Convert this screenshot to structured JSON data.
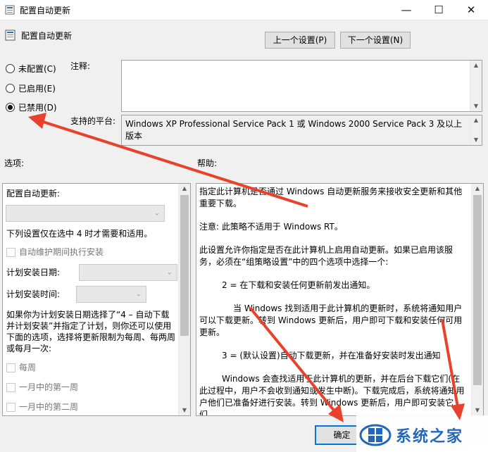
{
  "window": {
    "title": "配置自动更新",
    "minimize_icon": "minimize-icon",
    "maximize_icon": "maximize-icon",
    "close_icon": "close-icon"
  },
  "header": {
    "policy_name": "配置自动更新",
    "prev_button": "上一个设置(P)",
    "next_button": "下一个设置(N)"
  },
  "state_options": [
    {
      "label": "未配置(C)",
      "selected": false
    },
    {
      "label": "已启用(E)",
      "selected": false
    },
    {
      "label": "已禁用(D)",
      "selected": true
    }
  ],
  "comment": {
    "label": "注释:",
    "value": ""
  },
  "platform": {
    "label": "支持的平台:",
    "value": "Windows XP Professional Service Pack 1 或 Windows 2000 Service Pack 3 及以上版本"
  },
  "options_label": "选项:",
  "help_label": "帮助:",
  "options": {
    "configure_label": "配置自动更新:",
    "note": "下列设置仅在选中 4 时才需要和适用。",
    "maintenance_checkbox": "自动维护期间执行安装",
    "install_day_label": "计划安装日期:",
    "install_time_label": "计划安装时间:",
    "paragraph": "如果你为计划安装日期选择了“4 – 自动下载并计划安装”并指定了计划，则你还可以使用下面的选项，选择将更新限制为每周、每两周或每月一次:",
    "weekly_checkbox": "每周",
    "first_week_checkbox": "一月中的第一周",
    "second_week_checkbox": "一月中的第二周"
  },
  "help": {
    "p1": "指定此计算机是否通过 Windows 自动更新服务来接收安全更新和其他重要下载。",
    "p2": "注意: 此策略不适用于 Windows RT。",
    "p3": "此设置允许你指定是否在此计算机上启用自动更新。如果已启用该服务，必须在“组策略设置”中的四个选项中选择一个:",
    "p4": "2 = 在下载和安装任何更新前发出通知。",
    "p5": "当 Windows 找到适用于此计算机的更新时，系统将通知用户可以下载更新。转到 Windows 更新后，用户即可下载和安装任何可用更新。",
    "p6": "3 = (默认设置)自动下载更新，并在准备好安装时发出通知",
    "p7": "Windows 会查找适用于此计算机的更新，并在后台下载它们(在此过程中，用户不会收到通知或发生中断)。下载完成后，系统将通知用户他们已准备好进行安装。转到 Windows 更新后，用户即可安装它们。"
  },
  "footer": {
    "ok_button": "确定"
  },
  "watermark": {
    "text": "系统之家"
  },
  "colors": {
    "annotation_arrow": "#e8412c",
    "dialog_bg": "#f0f0f0"
  }
}
